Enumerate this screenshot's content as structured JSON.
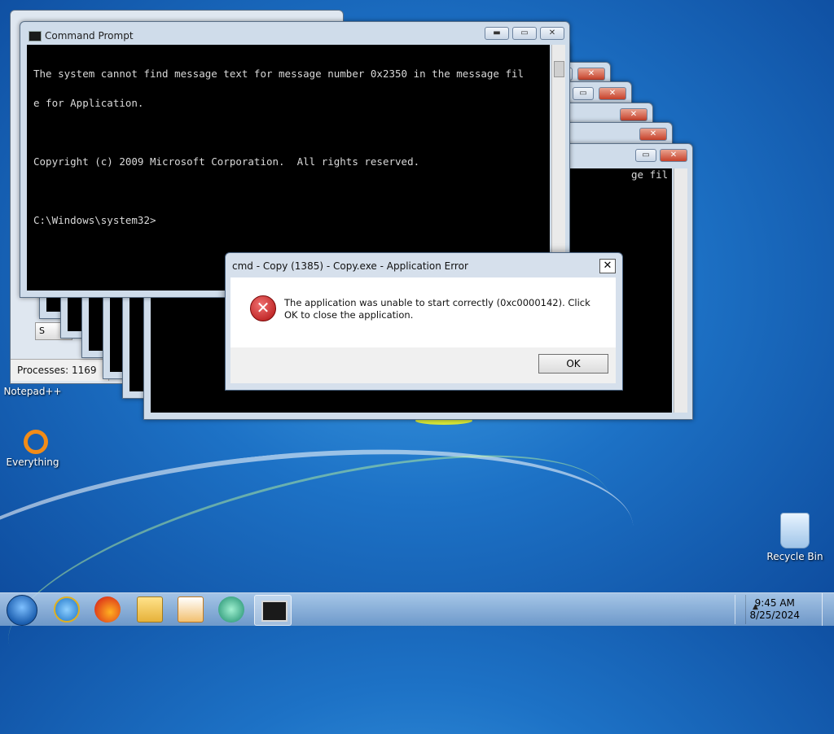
{
  "main_cmd": {
    "title": "Command Prompt",
    "lines": [
      "The system cannot find message text for message number 0x2350 in the message fil",
      "e for Application.",
      "",
      "Copyright (c) 2009 Microsoft Corporation.  All rights reserved.",
      "",
      "C:\\Windows\\system32>"
    ]
  },
  "stacked_cmd": {
    "fragment": "ge fil"
  },
  "taskmgr": {
    "processes": "Processes: 1169",
    "button_fragment": "S"
  },
  "dialog": {
    "title": "cmd - Copy (1385) - Copy.exe - Application Error",
    "message": "The application was unable to start correctly (0xc0000142). Click OK to close the application.",
    "ok_label": "OK",
    "close_glyph": "✕"
  },
  "desktop": {
    "icons": [
      "Notepad++",
      "Everything",
      "Recycle Bin"
    ]
  },
  "taskbar": {
    "time": "9:45 AM",
    "date": "8/25/2024",
    "apps": [
      "internet-explorer-icon",
      "firefox-icon",
      "file-explorer-icon",
      "media-player-icon",
      "app-icon",
      "cmd-icon"
    ]
  },
  "colors": {
    "error_red": "#c7412a",
    "desktop_blue": "#1d72c6",
    "console_bg": "#000000"
  }
}
